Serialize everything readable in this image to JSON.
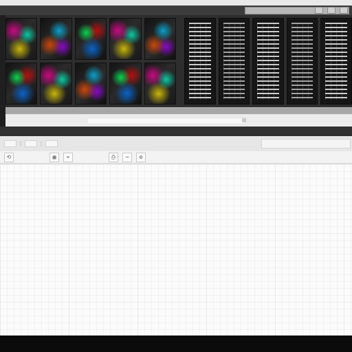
{
  "colors": {
    "dark_band": "#3c3c3c",
    "filmstrip_bg": "#2e2e2e",
    "panel_light": "#ececec",
    "canvas_bg": "#fbfbfb",
    "bottom_bar": "#0b0b0b"
  },
  "filmstrip": {
    "photo_thumbnails": 10,
    "document_thumbnails": 5
  },
  "toolbar": {
    "buttons": [
      {
        "name": "back-icon",
        "label": ""
      },
      {
        "name": "grid-icon",
        "label": ""
      },
      {
        "name": "cursor-icon",
        "label": ""
      },
      {
        "name": "print-icon",
        "label": ""
      },
      {
        "name": "more-icon",
        "label": ""
      },
      {
        "name": "settings-icon",
        "label": ""
      }
    ]
  },
  "status": {
    "progress": 0.0
  }
}
